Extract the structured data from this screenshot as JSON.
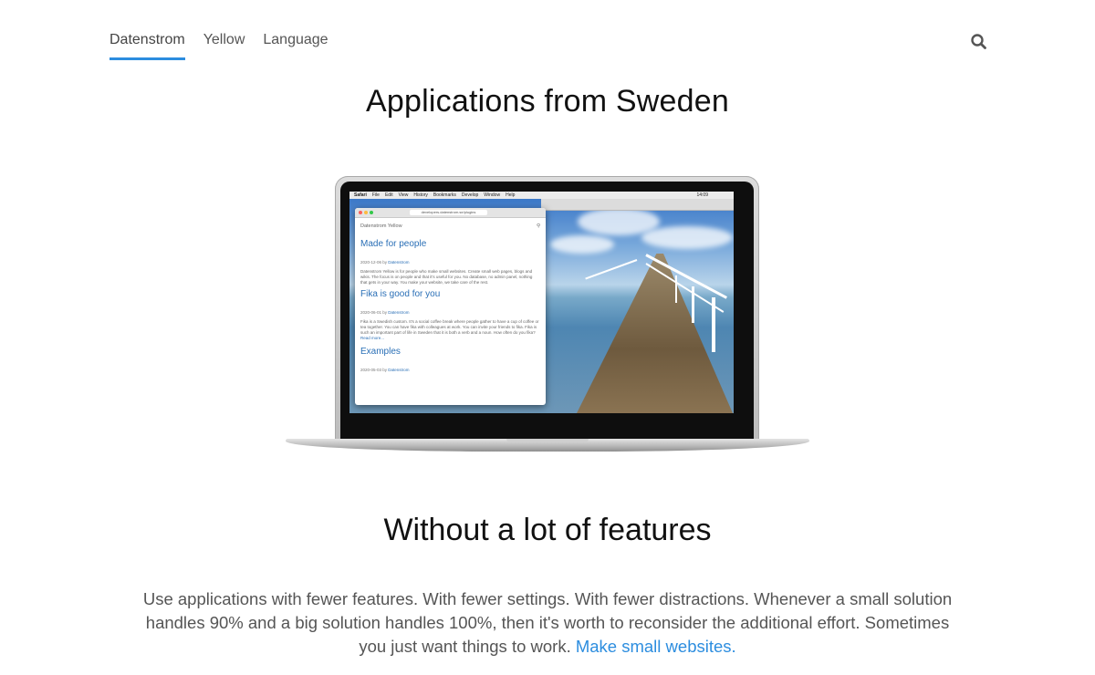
{
  "nav": {
    "items": [
      {
        "label": "Datenstrom",
        "active": true
      },
      {
        "label": "Yellow",
        "active": false
      },
      {
        "label": "Language",
        "active": false
      }
    ],
    "search_icon": "search-icon"
  },
  "hero": {
    "title": "Applications from Sweden",
    "image": {
      "menubar": [
        "Safari",
        "File",
        "Edit",
        "View",
        "History",
        "Bookmarks",
        "Develop",
        "Window",
        "Help"
      ],
      "clock": "14:09",
      "url": "developers.datenstrom.se/plugins",
      "site_name": "Datenstrom Yellow",
      "posts": [
        {
          "title": "Made for people",
          "date": "2020-12-06 by",
          "author": "Datenstrom",
          "text": "Datenstrom Yellow is for people who make small websites. Create small web pages, blogs and wikis. The focus is on people and that it's useful for you. No database, no admin panel, nothing that gets in your way. You make your website, we take care of the rest."
        },
        {
          "title": "Fika is good for you",
          "date": "2020-06-01 by",
          "author": "Datenstrom",
          "text": "Fika is a Swedish custom. It's a social coffee break where people gather to have a cup of coffee or tea together. You can have fika with colleagues at work. You can invite your friends to fika. Fika is such an important part of life in Sweden that it is both a verb and a noun. How often do you fika?",
          "read_more": "Read more..."
        },
        {
          "title": "Examples",
          "date": "2020-05-03 by",
          "author": "Datenstrom"
        }
      ]
    }
  },
  "section": {
    "title": "Without a lot of features",
    "text": "Use applications with fewer features. With fewer settings. With fewer distractions. Whenever a small solution handles 90% and a big solution handles 100%, then it's worth to reconsider the additional effort. Sometimes you just want things to work.",
    "link": "Make small websites."
  },
  "colors": {
    "accent": "#2c8ddf",
    "text": "#111111",
    "muted": "#555555"
  }
}
